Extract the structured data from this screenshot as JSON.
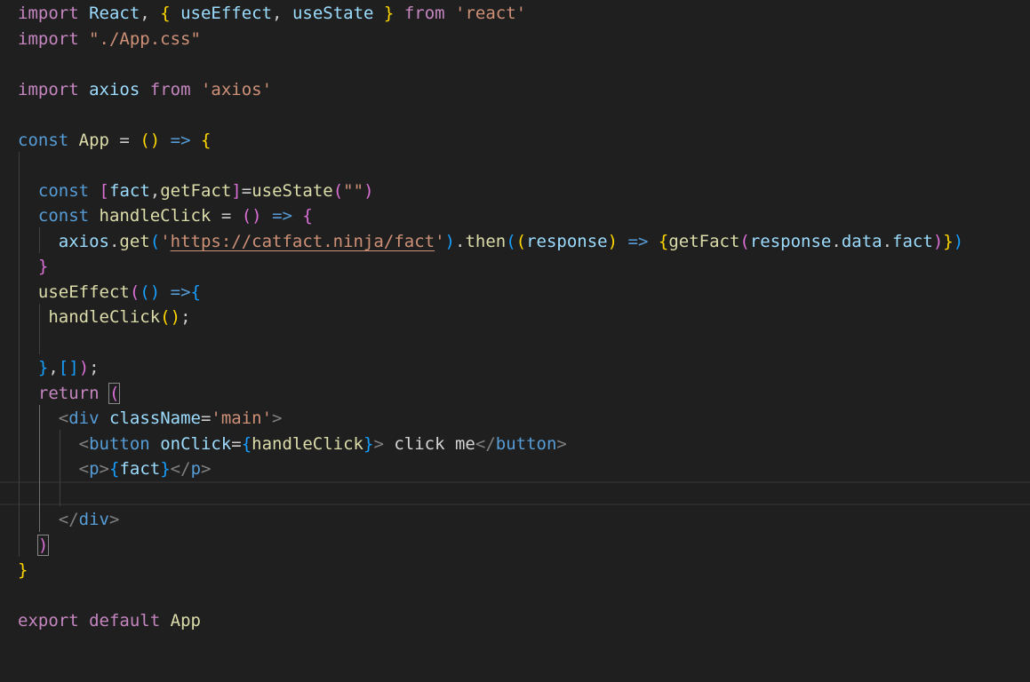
{
  "editor": {
    "colors": {
      "background": "#1f1f1f",
      "keyword": "#569cd6",
      "control": "#c586c0",
      "variable": "#9cdcfe",
      "function": "#dcdcaa",
      "string": "#ce9178",
      "bracket_gold": "#ffd700",
      "bracket_orchid": "#da70d6",
      "bracket_blue": "#179fff"
    },
    "lines": [
      [
        {
          "t": "import",
          "c": "control"
        },
        {
          "t": " ",
          "c": "plain"
        },
        {
          "t": "React",
          "c": "var"
        },
        {
          "t": ", ",
          "c": "plain"
        },
        {
          "t": "{",
          "c": "b1"
        },
        {
          "t": " ",
          "c": "plain"
        },
        {
          "t": "useEffect",
          "c": "var"
        },
        {
          "t": ", ",
          "c": "plain"
        },
        {
          "t": "useState",
          "c": "var"
        },
        {
          "t": " ",
          "c": "plain"
        },
        {
          "t": "}",
          "c": "b1"
        },
        {
          "t": " ",
          "c": "plain"
        },
        {
          "t": "from",
          "c": "control"
        },
        {
          "t": " ",
          "c": "plain"
        },
        {
          "t": "'react'",
          "c": "string"
        }
      ],
      [
        {
          "t": "import",
          "c": "control"
        },
        {
          "t": " ",
          "c": "plain"
        },
        {
          "t": "\"./App.css\"",
          "c": "string"
        }
      ],
      [],
      [
        {
          "t": "import",
          "c": "control"
        },
        {
          "t": " ",
          "c": "plain"
        },
        {
          "t": "axios",
          "c": "var"
        },
        {
          "t": " ",
          "c": "plain"
        },
        {
          "t": "from",
          "c": "control"
        },
        {
          "t": " ",
          "c": "plain"
        },
        {
          "t": "'axios'",
          "c": "string"
        }
      ],
      [],
      [
        {
          "t": "const",
          "c": "keyword"
        },
        {
          "t": " ",
          "c": "plain"
        },
        {
          "t": "App",
          "c": "func"
        },
        {
          "t": " = ",
          "c": "plain"
        },
        {
          "t": "()",
          "c": "b1"
        },
        {
          "t": " ",
          "c": "plain"
        },
        {
          "t": "=>",
          "c": "keyword"
        },
        {
          "t": " ",
          "c": "plain"
        },
        {
          "t": "{",
          "c": "b1"
        }
      ],
      [],
      [
        {
          "t": "  ",
          "c": "plain"
        },
        {
          "t": "const",
          "c": "keyword"
        },
        {
          "t": " ",
          "c": "plain"
        },
        {
          "t": "[",
          "c": "b2"
        },
        {
          "t": "fact",
          "c": "var"
        },
        {
          "t": ",",
          "c": "plain"
        },
        {
          "t": "getFact",
          "c": "func"
        },
        {
          "t": "]",
          "c": "b2"
        },
        {
          "t": "=",
          "c": "plain"
        },
        {
          "t": "useState",
          "c": "func"
        },
        {
          "t": "(",
          "c": "b2"
        },
        {
          "t": "\"\"",
          "c": "string"
        },
        {
          "t": ")",
          "c": "b2"
        }
      ],
      [
        {
          "t": "  ",
          "c": "plain"
        },
        {
          "t": "const",
          "c": "keyword"
        },
        {
          "t": " ",
          "c": "plain"
        },
        {
          "t": "handleClick",
          "c": "func"
        },
        {
          "t": " = ",
          "c": "plain"
        },
        {
          "t": "()",
          "c": "b2"
        },
        {
          "t": " ",
          "c": "plain"
        },
        {
          "t": "=>",
          "c": "keyword"
        },
        {
          "t": " ",
          "c": "plain"
        },
        {
          "t": "{",
          "c": "b2"
        }
      ],
      [
        {
          "t": "    ",
          "c": "plain"
        },
        {
          "t": "axios",
          "c": "var"
        },
        {
          "t": ".",
          "c": "plain"
        },
        {
          "t": "get",
          "c": "func"
        },
        {
          "t": "(",
          "c": "b3"
        },
        {
          "t": "'",
          "c": "string"
        },
        {
          "t": "https://catfact.ninja/fact",
          "c": "string",
          "u": true
        },
        {
          "t": "'",
          "c": "string"
        },
        {
          "t": ")",
          "c": "b3"
        },
        {
          "t": ".",
          "c": "plain"
        },
        {
          "t": "then",
          "c": "func"
        },
        {
          "t": "(",
          "c": "b3"
        },
        {
          "t": "(",
          "c": "b1"
        },
        {
          "t": "response",
          "c": "var"
        },
        {
          "t": ")",
          "c": "b1"
        },
        {
          "t": " ",
          "c": "plain"
        },
        {
          "t": "=>",
          "c": "keyword"
        },
        {
          "t": " ",
          "c": "plain"
        },
        {
          "t": "{",
          "c": "b1"
        },
        {
          "t": "getFact",
          "c": "func"
        },
        {
          "t": "(",
          "c": "b2"
        },
        {
          "t": "response",
          "c": "var"
        },
        {
          "t": ".",
          "c": "plain"
        },
        {
          "t": "data",
          "c": "var"
        },
        {
          "t": ".",
          "c": "plain"
        },
        {
          "t": "fact",
          "c": "var"
        },
        {
          "t": ")",
          "c": "b2"
        },
        {
          "t": "}",
          "c": "b1"
        },
        {
          "t": ")",
          "c": "b3"
        }
      ],
      [
        {
          "t": "  ",
          "c": "plain"
        },
        {
          "t": "}",
          "c": "b2"
        }
      ],
      [
        {
          "t": "  ",
          "c": "plain"
        },
        {
          "t": "useEffect",
          "c": "func"
        },
        {
          "t": "(",
          "c": "b2"
        },
        {
          "t": "()",
          "c": "b3"
        },
        {
          "t": " ",
          "c": "plain"
        },
        {
          "t": "=>",
          "c": "keyword"
        },
        {
          "t": "{",
          "c": "b3"
        }
      ],
      [
        {
          "t": "   ",
          "c": "plain"
        },
        {
          "t": "handleClick",
          "c": "func"
        },
        {
          "t": "()",
          "c": "b1"
        },
        {
          "t": ";",
          "c": "plain"
        }
      ],
      [],
      [
        {
          "t": "  ",
          "c": "plain"
        },
        {
          "t": "}",
          "c": "b3"
        },
        {
          "t": ",",
          "c": "plain"
        },
        {
          "t": "[]",
          "c": "b3"
        },
        {
          "t": ")",
          "c": "b2"
        },
        {
          "t": ";",
          "c": "plain"
        }
      ],
      [
        {
          "t": "  ",
          "c": "plain"
        },
        {
          "t": "return",
          "c": "control"
        },
        {
          "t": " ",
          "c": "plain"
        },
        {
          "t": "(",
          "c": "b2",
          "m": true
        }
      ],
      [
        {
          "t": "    ",
          "c": "plain"
        },
        {
          "t": "<",
          "c": "tagpunct"
        },
        {
          "t": "div",
          "c": "tag"
        },
        {
          "t": " ",
          "c": "plain"
        },
        {
          "t": "className",
          "c": "attr"
        },
        {
          "t": "=",
          "c": "plain"
        },
        {
          "t": "'main'",
          "c": "string"
        },
        {
          "t": ">",
          "c": "tagpunct"
        }
      ],
      [
        {
          "t": "      ",
          "c": "plain"
        },
        {
          "t": "<",
          "c": "tagpunct"
        },
        {
          "t": "button",
          "c": "tag"
        },
        {
          "t": " ",
          "c": "plain"
        },
        {
          "t": "onClick",
          "c": "attr"
        },
        {
          "t": "=",
          "c": "plain"
        },
        {
          "t": "{",
          "c": "b3"
        },
        {
          "t": "handleClick",
          "c": "func"
        },
        {
          "t": "}",
          "c": "b3"
        },
        {
          "t": ">",
          "c": "tagpunct"
        },
        {
          "t": " click me",
          "c": "jsxtext"
        },
        {
          "t": "</",
          "c": "tagpunct"
        },
        {
          "t": "button",
          "c": "tag"
        },
        {
          "t": ">",
          "c": "tagpunct"
        }
      ],
      [
        {
          "t": "      ",
          "c": "plain"
        },
        {
          "t": "<",
          "c": "tagpunct"
        },
        {
          "t": "p",
          "c": "tag"
        },
        {
          "t": ">",
          "c": "tagpunct"
        },
        {
          "t": "{",
          "c": "b3"
        },
        {
          "t": "fact",
          "c": "var"
        },
        {
          "t": "}",
          "c": "b3"
        },
        {
          "t": "</",
          "c": "tagpunct"
        },
        {
          "t": "p",
          "c": "tag"
        },
        {
          "t": ">",
          "c": "tagpunct"
        }
      ],
      [],
      [
        {
          "t": "    ",
          "c": "plain"
        },
        {
          "t": "</",
          "c": "tagpunct"
        },
        {
          "t": "div",
          "c": "tag"
        },
        {
          "t": ">",
          "c": "tagpunct"
        }
      ],
      [
        {
          "t": "  ",
          "c": "plain"
        },
        {
          "t": ")",
          "c": "b2",
          "m": true
        }
      ],
      [
        {
          "t": "}",
          "c": "b1"
        }
      ],
      [],
      [
        {
          "t": "export",
          "c": "control"
        },
        {
          "t": " ",
          "c": "plain"
        },
        {
          "t": "default",
          "c": "control"
        },
        {
          "t": " ",
          "c": "plain"
        },
        {
          "t": "App",
          "c": "func"
        }
      ]
    ]
  }
}
